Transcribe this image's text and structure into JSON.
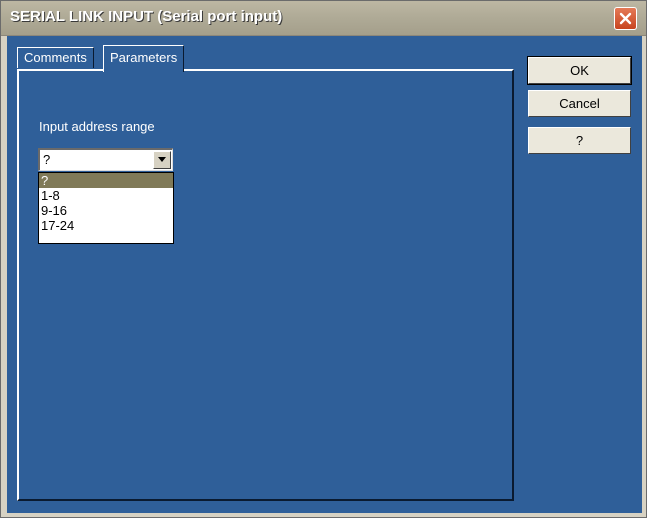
{
  "window": {
    "title": "SERIAL LINK INPUT (Serial port input)",
    "close_icon": "close-icon",
    "colors": {
      "titlebar": "#b0ab97",
      "client": "#2f5f99",
      "close": "#c8441e",
      "selected_option": "#807a58"
    }
  },
  "tabs": [
    {
      "label": "Comments",
      "active": false
    },
    {
      "label": "Parameters",
      "active": true
    }
  ],
  "parameters": {
    "input_range_label": "Input address range",
    "combo": {
      "value": "?",
      "arrow_icon": "chevron-down-icon",
      "options": [
        "?",
        "1-8",
        "9-16",
        "17-24"
      ],
      "selected_index": 0
    }
  },
  "buttons": {
    "ok": "OK",
    "cancel": "Cancel",
    "help": "?"
  }
}
